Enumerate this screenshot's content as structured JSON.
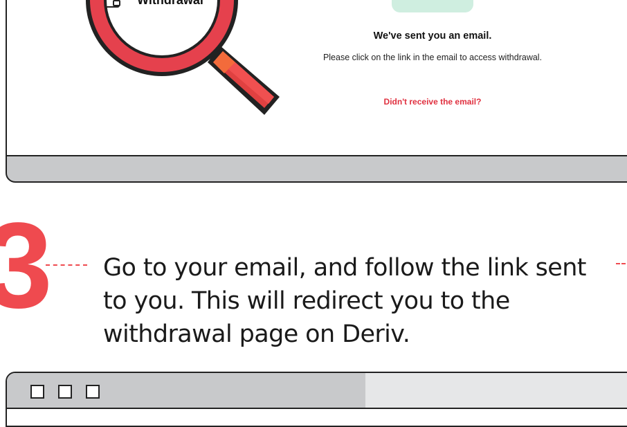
{
  "top_panel": {
    "tab_label": "Withdrawal",
    "email_title": "We've sent you an email.",
    "email_description": "Please click on the link in the email to access withdrawal.",
    "resend_link": "Didn't receive the email?"
  },
  "step": {
    "number": "3",
    "instruction": "Go to your email, and follow the link sent to you. This will redirect you to the withdrawal page on Deriv."
  },
  "colors": {
    "accent_red": "#ef4a4f",
    "link_red": "#e0303f",
    "frame_gray": "#c8c9cb",
    "envelope_green": "#cfeee0"
  },
  "icons": [
    "magnifier-icon",
    "wallet-icon",
    "envelope-icon",
    "window-button-icon"
  ]
}
